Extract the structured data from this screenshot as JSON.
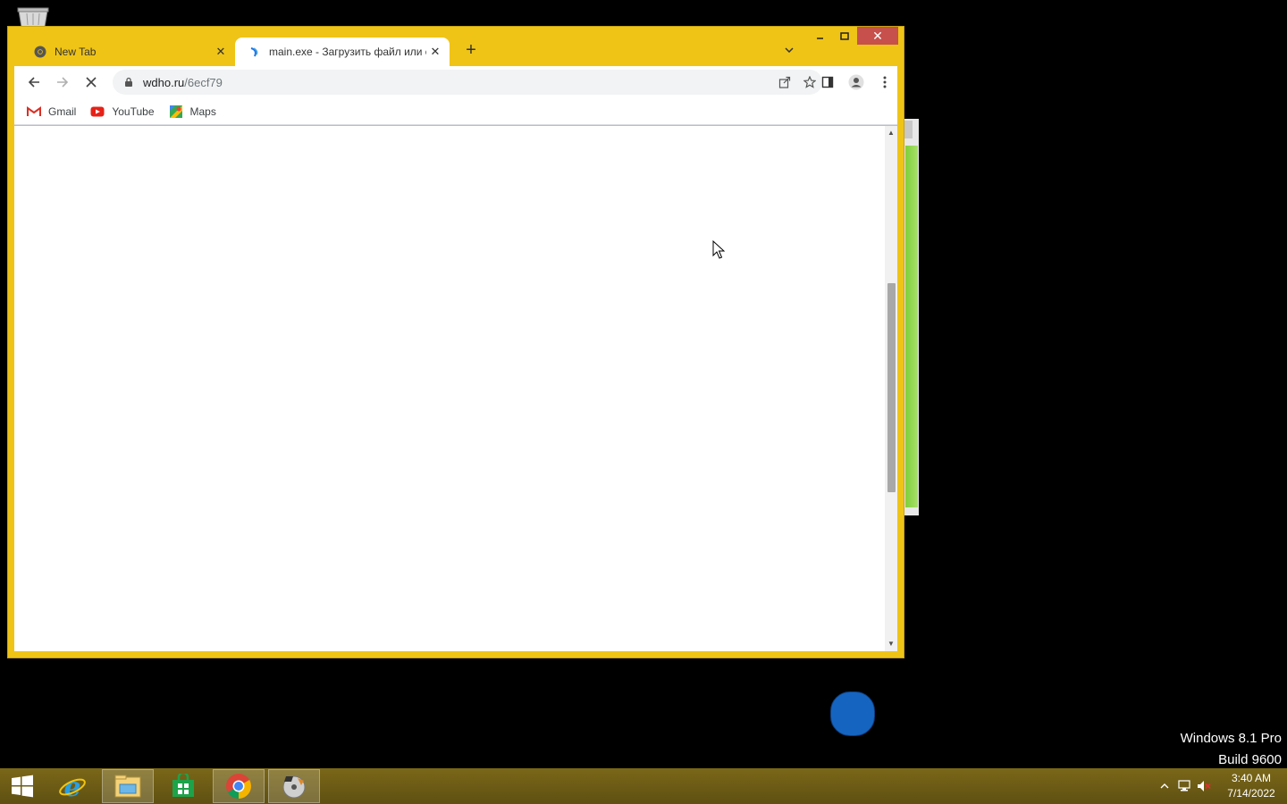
{
  "browser": {
    "tabs": [
      {
        "title": "New Tab",
        "active": false,
        "favicon": "chrome-icon"
      },
      {
        "title": "main.exe - Загрузить файл или с",
        "active": true,
        "favicon": "wdho-icon"
      }
    ],
    "address": {
      "host": "wdho.ru",
      "path": "/6ecf79"
    },
    "bookmarks": [
      {
        "label": "Gmail",
        "icon": "gmail-icon"
      },
      {
        "label": "YouTube",
        "icon": "youtube-icon"
      },
      {
        "label": "Maps",
        "icon": "maps-icon"
      }
    ],
    "loading": true
  },
  "watermark": {
    "line1": "Windows 8.1 Pro",
    "line2": "Build 9600"
  },
  "taskbar": {
    "apps": [
      "start-icon",
      "internet-explorer-icon",
      "file-explorer-icon",
      "store-icon",
      "chrome-icon",
      "media-app-icon"
    ],
    "clock": {
      "time": "3:40 AM",
      "date": "7/14/2022"
    }
  },
  "colors": {
    "window_frame": "#efc416",
    "taskbar": "#6b5a16",
    "fab": "#1565c0"
  }
}
